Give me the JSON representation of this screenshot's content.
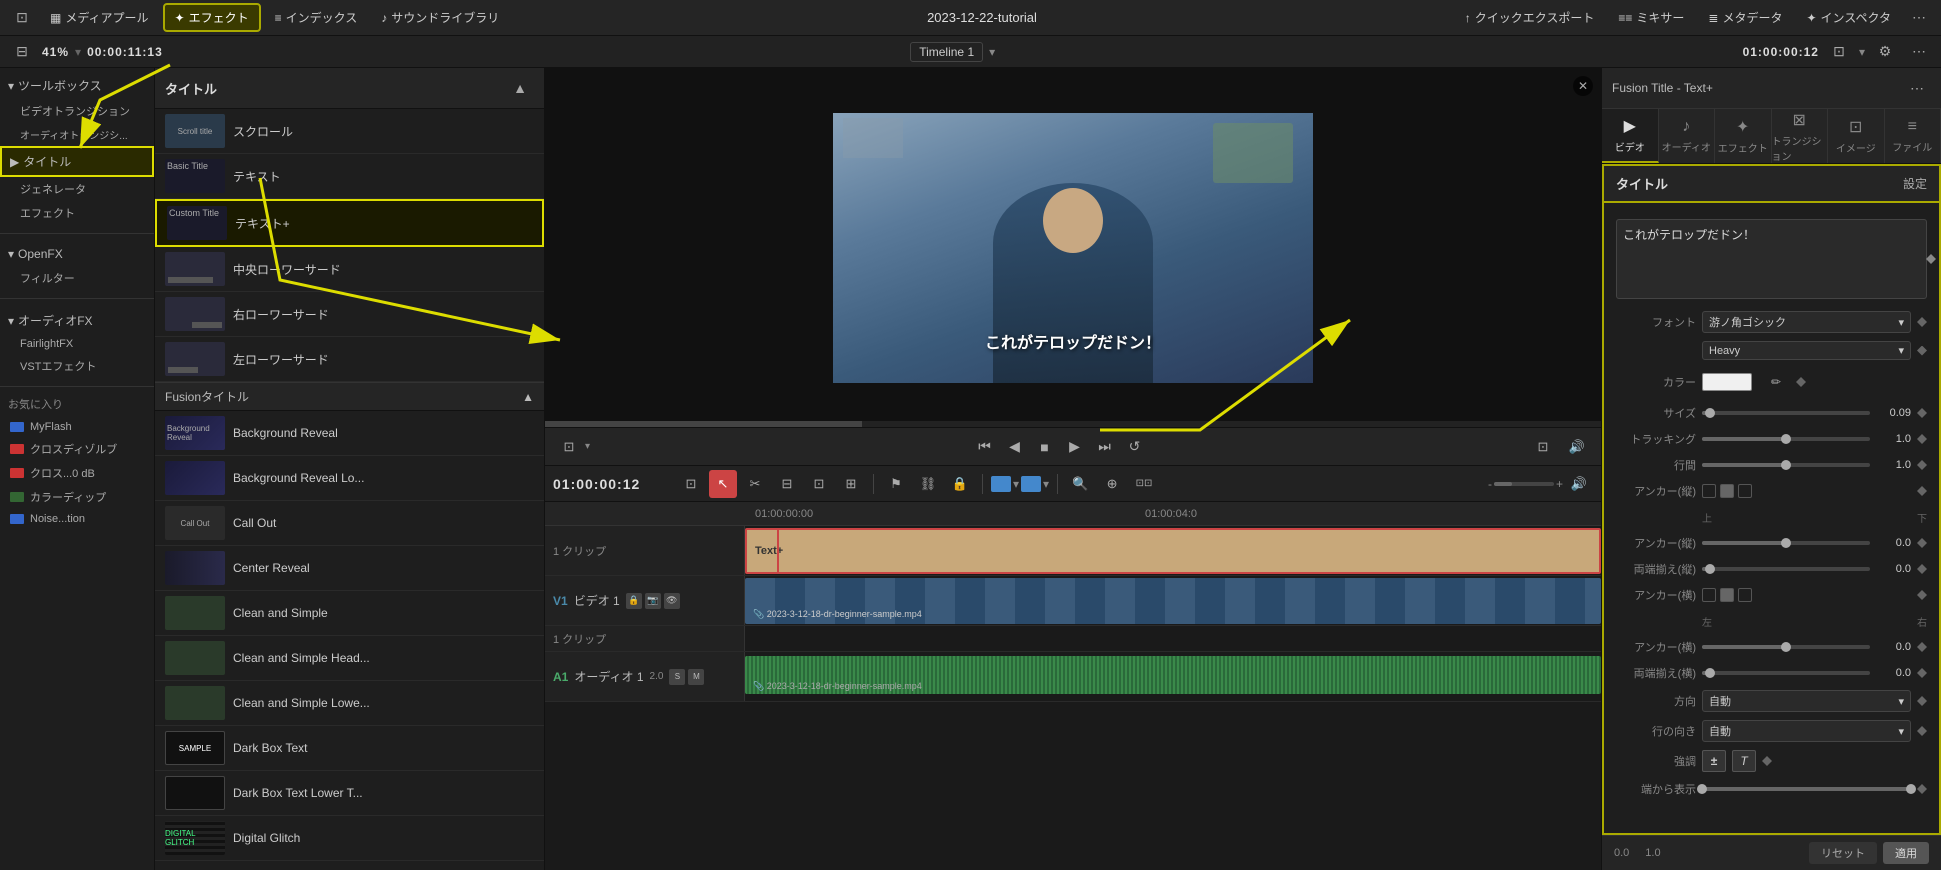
{
  "topbar": {
    "buttons": [
      {
        "label": "メディアプール",
        "icon": "▦",
        "active": false
      },
      {
        "label": "エフェクト",
        "icon": "✦",
        "active": true
      },
      {
        "label": "インデックス",
        "icon": "≡",
        "active": false
      },
      {
        "label": "サウンドライブラリ",
        "icon": "♪",
        "active": false
      }
    ],
    "title": "2023-12-22-tutorial",
    "rightButtons": [
      {
        "label": "クイックエクスポート",
        "icon": "↑"
      },
      {
        "label": "ミキサー",
        "icon": "≡≡"
      },
      {
        "label": "メタデータ",
        "icon": "≣"
      },
      {
        "label": "インスペクタ",
        "icon": "✦"
      }
    ],
    "collapse_icon": "⬜",
    "more_icon": "⋯",
    "window_icon": "⊡"
  },
  "secondbar": {
    "zoom": "41%",
    "timecode_left": "00:00:11:13",
    "timeline_name": "Timeline 1",
    "timecode_right": "01:00:00:12"
  },
  "leftpanel": {
    "sections": [
      {
        "label": "ツールボックス",
        "icon": "▾",
        "active": false
      },
      {
        "label": "ビデオトランジション",
        "icon": "▾",
        "indent": true,
        "active": false
      },
      {
        "label": "オーディオトランジシ...",
        "indent": true,
        "active": false
      },
      {
        "label": "タイトル",
        "icon": "▶",
        "active": true,
        "highlight": true
      },
      {
        "label": "ジェネレータ",
        "indent": true,
        "active": false
      },
      {
        "label": "エフェクト",
        "indent": true,
        "active": false
      },
      {
        "label": "OpenFX",
        "active": false
      },
      {
        "label": "フィルター",
        "indent": true,
        "active": false
      },
      {
        "label": "オーディオFX",
        "active": false
      },
      {
        "label": "FairlightFX",
        "indent": true,
        "active": false
      },
      {
        "label": "VSTエフェクト",
        "indent": true,
        "active": false
      }
    ],
    "favorites_label": "お気に入り",
    "favorites": [
      {
        "label": "MyFlash",
        "icon_color": "blue"
      },
      {
        "label": "クロスディゾルブ",
        "icon_color": "red"
      },
      {
        "label": "クロス...0 dB",
        "icon_color": "red"
      },
      {
        "label": "カラーディップ",
        "icon_color": "green"
      },
      {
        "label": "Noise...tion",
        "icon_color": "blue"
      }
    ]
  },
  "effectspanel": {
    "title_section": "タイトル",
    "title_items": [
      {
        "thumb_style": "scroll",
        "name": "スクロール"
      },
      {
        "thumb_style": "text",
        "name": "テキスト"
      },
      {
        "thumb_style": "textplus",
        "name": "テキスト+",
        "highlight": true
      }
    ],
    "lower_items": [
      {
        "name": "中央ローワーサード"
      },
      {
        "name": "右ローワーサード"
      },
      {
        "name": "左ローワーサード"
      }
    ],
    "fusion_section": "Fusionタイトル",
    "fusion_items": [
      {
        "name": "Background Reveal"
      },
      {
        "name": "Background Reveal Lo..."
      },
      {
        "name": "Call Out"
      },
      {
        "name": "Center Reveal"
      },
      {
        "name": "Clean and Simple"
      },
      {
        "name": "Clean and Simple Head..."
      },
      {
        "name": "Clean and Simple Lowe..."
      },
      {
        "name": "Dark Box Text"
      },
      {
        "name": "Dark Box Text Lower T..."
      },
      {
        "name": "Digital Glitch"
      }
    ]
  },
  "preview": {
    "text_overlay": "これがテロップだドン！",
    "close_label": "✕"
  },
  "transport": {
    "timecode": "01:00:00:12",
    "buttons": [
      "⏮",
      "◀",
      "■",
      "▶",
      "⏭",
      "↺"
    ]
  },
  "tools": {
    "buttons": [
      "⊡",
      "↖",
      "✂",
      "◉",
      "⊡",
      "⊞",
      "⊟",
      "⊠",
      "↺",
      "⛓",
      "🔒"
    ]
  },
  "timeline": {
    "ruler_marks": [
      "01:00:00:00",
      "",
      "",
      "",
      "01:00:04:0"
    ],
    "tracks": [
      {
        "type": "clip",
        "label": "1 クリップ",
        "clips": [
          {
            "label": "Text+",
            "color": "tan",
            "selected": true
          }
        ]
      },
      {
        "type": "video",
        "label": "ビデオ 1",
        "track_id": "V1",
        "clips": [
          {
            "label": "2023-3-12-18-dr-beginner-sample.mp4",
            "color": "blue"
          }
        ]
      },
      {
        "type": "clip",
        "label": "1 クリップ",
        "clips": []
      },
      {
        "type": "audio",
        "label": "オーディオ 1",
        "track_id": "A1",
        "gain": "2.0",
        "clips": [
          {
            "label": "2023-3-12-18-dr-beginner-sample.mp4",
            "color": "green"
          }
        ]
      }
    ]
  },
  "inspector": {
    "title": "Fusion Title - Text+",
    "tabs": [
      {
        "label": "ビデオ",
        "icon": "▶",
        "active": true
      },
      {
        "label": "オーディオ",
        "icon": "♪",
        "active": false
      },
      {
        "label": "エフェクト",
        "icon": "✦",
        "active": false
      },
      {
        "label": "トランジション",
        "icon": "⊠",
        "active": false
      },
      {
        "label": "イメージ",
        "icon": "⊡",
        "active": false
      },
      {
        "label": "ファイル",
        "icon": "≡",
        "active": false
      }
    ],
    "panel_title": "タイトル",
    "panel_settings": "設定",
    "text_value": "これがテロップだドン！",
    "properties": [
      {
        "label": "フォント",
        "type": "select",
        "value": "游ノ角ゴシック"
      },
      {
        "label": "",
        "type": "select",
        "value": "Heavy"
      },
      {
        "label": "カラー",
        "type": "color",
        "value": "#f0f0f0"
      },
      {
        "label": "サイズ",
        "type": "slider",
        "value": "0.09",
        "fill_pct": 5
      },
      {
        "label": "トラッキング",
        "type": "slider",
        "value": "1.0",
        "fill_pct": 50
      },
      {
        "label": "行間",
        "type": "slider",
        "value": "1.0",
        "fill_pct": 50
      },
      {
        "label": "アンカー(縦)",
        "type": "anchor3",
        "value": ""
      },
      {
        "label": "",
        "type": "label2",
        "value1": "上",
        "value2": "下"
      },
      {
        "label": "アンカー(縦)",
        "type": "slider",
        "value": "0.0",
        "fill_pct": 50
      },
      {
        "label": "両端揃え(縦)",
        "type": "slider",
        "value": "0.0",
        "fill_pct": 5
      },
      {
        "label": "アンカー(横)",
        "type": "anchor3",
        "value": ""
      },
      {
        "label": "",
        "type": "label2",
        "value1": "左",
        "value2": "右"
      },
      {
        "label": "アンカー(横)",
        "type": "slider",
        "value": "0.0",
        "fill_pct": 50
      },
      {
        "label": "両端揃え(横)",
        "type": "slider",
        "value": "0.0",
        "fill_pct": 5
      },
      {
        "label": "方向",
        "type": "select",
        "value": "自動"
      },
      {
        "label": "行の向き",
        "type": "select",
        "value": "自動"
      },
      {
        "label": "強調",
        "type": "bold_italic"
      },
      {
        "label": "端から表示",
        "type": "range_slider",
        "value1": "0.0",
        "value2": "1.0"
      }
    ],
    "footer": {
      "value1": "0.0",
      "value2": "1.0",
      "reset_label": "リセット",
      "apply_label": "適用"
    }
  },
  "arrows": {
    "items": [
      {
        "from": "title_nav",
        "to": "title_section"
      },
      {
        "from": "textplus_item",
        "to": "preview_text"
      },
      {
        "from": "inspector_panel",
        "to": "inspector_header"
      }
    ]
  }
}
